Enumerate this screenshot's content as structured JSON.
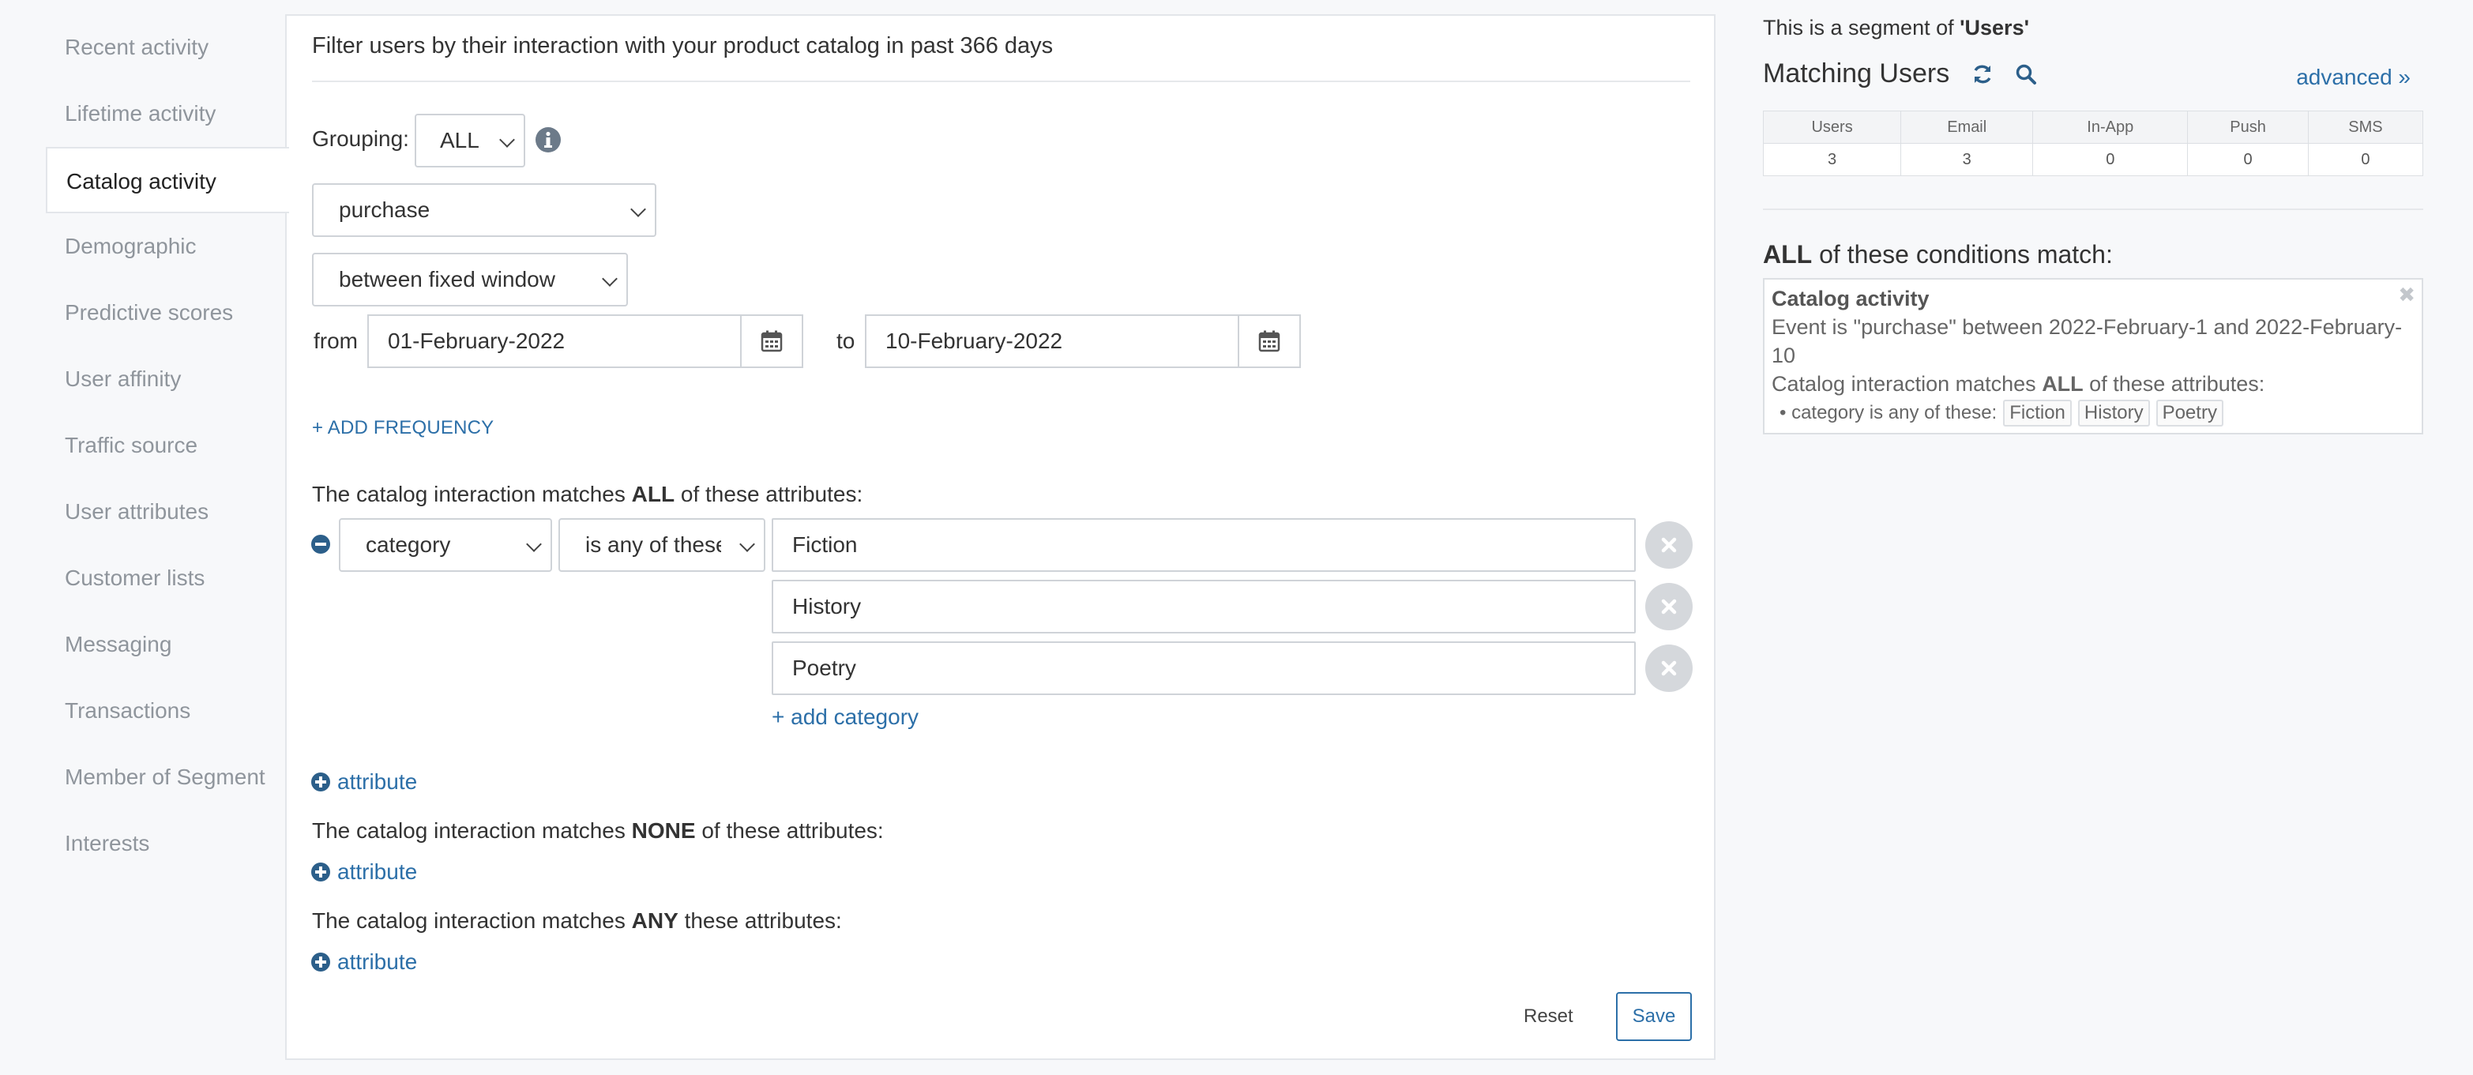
{
  "sidebar": {
    "items": [
      {
        "label": "Recent activity"
      },
      {
        "label": "Lifetime activity"
      },
      {
        "label": "Catalog activity"
      },
      {
        "label": "Demographic"
      },
      {
        "label": "Predictive scores"
      },
      {
        "label": "User affinity"
      },
      {
        "label": "Traffic source"
      },
      {
        "label": "User attributes"
      },
      {
        "label": "Customer lists"
      },
      {
        "label": "Messaging"
      },
      {
        "label": "Transactions"
      },
      {
        "label": "Member of Segment"
      },
      {
        "label": "Interests"
      }
    ],
    "active": "Catalog activity"
  },
  "main": {
    "header": "Filter users by their interaction with your product catalog in past 366 days",
    "grouping_label": "Grouping:",
    "grouping_value": "ALL",
    "event_value": "purchase",
    "window_value": "between fixed window",
    "from_label": "from",
    "from_date": "01-February-2022",
    "to_label": "to",
    "to_date": "10-February-2022",
    "add_frequency": "+ ADD FREQUENCY",
    "all_section": {
      "prefix": "The catalog interaction matches ",
      "keyword": "ALL",
      "suffix": " of these attributes:"
    },
    "attribute_value": "category",
    "operator_value": "is any of these",
    "values": [
      "Fiction",
      "History",
      "Poetry"
    ],
    "add_category": "+ add category",
    "attribute_link": "attribute",
    "none_section": {
      "prefix": "The catalog interaction matches ",
      "keyword": "NONE",
      "suffix": " of these attributes:"
    },
    "any_section": {
      "prefix": "The catalog interaction matches ",
      "keyword": "ANY",
      "suffix": " these attributes:"
    },
    "reset_label": "Reset",
    "save_label": "Save"
  },
  "right": {
    "segment_prefix": "This is a segment of ",
    "segment_name": "'Users'",
    "matching_title": "Matching Users",
    "advanced": "advanced »",
    "stats_headers": [
      "Users",
      "Email",
      "In-App",
      "Push",
      "SMS"
    ],
    "stats_values": [
      "3",
      "3",
      "0",
      "0",
      "0"
    ],
    "conditions_keyword": "ALL",
    "conditions_suffix": " of these conditions match:",
    "condition": {
      "heading": "Catalog activity",
      "event_line": "Event is \"purchase\" between 2022-February-1 and 2022-February-10",
      "match_prefix": "Catalog interaction matches ",
      "match_keyword": "ALL",
      "match_suffix": " of these attributes:",
      "bullet": "• category is any of these:",
      "tags": [
        "Fiction",
        "History",
        "Poetry"
      ]
    }
  },
  "colors": {
    "accent": "#2c6fa8",
    "border": "#cfd3d8",
    "muted": "#8f959c"
  }
}
